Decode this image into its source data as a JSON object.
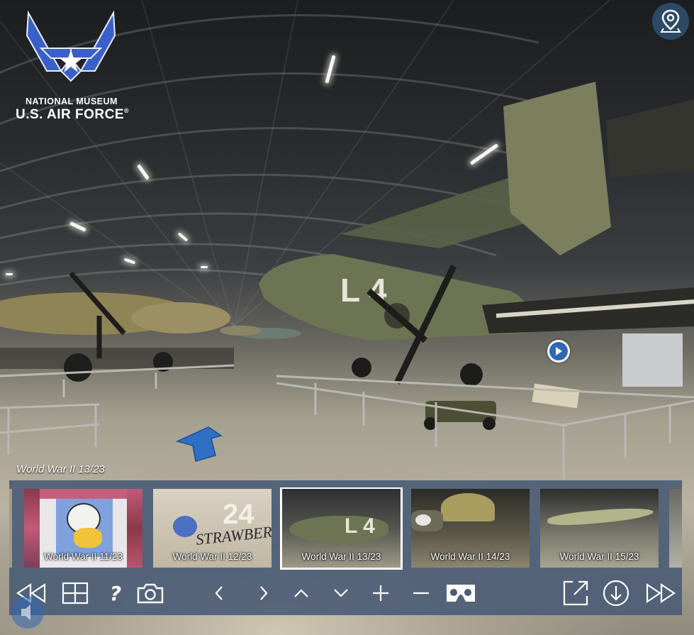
{
  "app": {
    "logo_line1": "NATIONAL MUSEUM",
    "logo_line2": "U.S. AIR FORCE",
    "logo_mark": "®"
  },
  "icons": {
    "map": "map-pin-icon",
    "hotspot": "play-icon",
    "navigate": "up-arrow-icon"
  },
  "scene": {
    "title": "World War II 13/23"
  },
  "thumbnails": [
    {
      "label": "World War II 11/23",
      "active": false
    },
    {
      "label": "World War II 12/23",
      "active": false
    },
    {
      "label": "World War II 13/23",
      "active": true
    },
    {
      "label": "World War II 14/23",
      "active": false
    },
    {
      "label": "World War II 15/23",
      "active": false
    }
  ],
  "toolbar": {
    "help_label": "?",
    "buttons": [
      "previous-scene",
      "thumbnails-grid",
      "help",
      "screenshot",
      "pan-left",
      "pan-right",
      "pan-up",
      "pan-down",
      "zoom-in",
      "zoom-out",
      "vr-mode",
      "fullscreen",
      "download",
      "next-scene"
    ]
  },
  "colors": {
    "panel": "#4a5c75",
    "accent": "#2f67b5",
    "map_button": "#2c4a66"
  }
}
